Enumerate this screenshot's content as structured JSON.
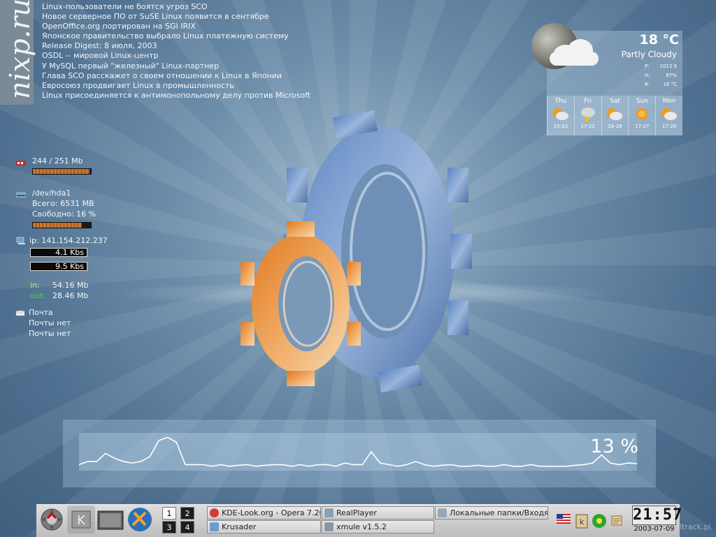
{
  "brand": {
    "logo": "nixp.ru",
    "watermark": "ltrack.pl"
  },
  "news": [
    "Linux-пользователи не боятся угроз SCO",
    "Новое серверное ПО от SuSE Linux появится в сентябре",
    "OpenOffice.org портирован на SGI IRIX",
    "Японское правительство выбрало Linux платежную систему",
    "Release Digest: 8 июля, 2003",
    "OSDL -- мировой Linux-центр",
    "У MySQL первый \"железный\" Linux-партнер",
    "Глава SCO расскажет о своем отношении к Linux в Японии",
    "Евросоюз продвигает Linux в промышленность",
    "Linux присоединяется к антимонопольному делу против Microsoft"
  ],
  "memory": {
    "icon": "memory-icon",
    "text": "244 / 251 Mb",
    "usage": 0.97
  },
  "disk": {
    "icon": "disk-icon",
    "device": "/dev/hda1",
    "total": "Всего: 6531 MB",
    "free": "Свободно: 16 %",
    "usage": 0.84
  },
  "network": {
    "icon": "network-icon",
    "ip": "ip: 141.154.212.237",
    "down_rate": "4.1 Kbs",
    "up_rate": "9.5 Kbs",
    "in_label": "in:",
    "in_value": "54.16 Mb",
    "out_label": "out:",
    "out_value": "28.46 Mb",
    "in_color": "#d8e85a",
    "out_color": "#4fcf4f"
  },
  "mail": {
    "icon": "mail-icon",
    "title": "Почта",
    "line1": "Почты нет",
    "line2": "Почты нет"
  },
  "weather": {
    "temp": "18 °C",
    "condition": "Partly Cloudy",
    "details": [
      {
        "k": "P:",
        "v": "1013.9"
      },
      {
        "k": "H:",
        "v": "87%"
      },
      {
        "k": "R:",
        "v": "18 °C"
      }
    ],
    "forecast": [
      {
        "day": "Thu",
        "range": "15-23",
        "icon": "sun-cloud-icon"
      },
      {
        "day": "Fri",
        "range": "17-22",
        "icon": "storm-icon"
      },
      {
        "day": "Sat",
        "range": "16-26",
        "icon": "sun-cloud-icon"
      },
      {
        "day": "Sun",
        "range": "17-27",
        "icon": "sun-icon"
      },
      {
        "day": "Mon",
        "range": "17-28",
        "icon": "sun-cloud-icon"
      }
    ]
  },
  "cpu": {
    "percent_label": "13 %",
    "load": [
      0.1,
      0.2,
      0.2,
      0.45,
      0.3,
      0.2,
      0.15,
      0.2,
      0.35,
      0.85,
      0.95,
      0.8,
      0.1,
      0.1,
      0.1,
      0.05,
      0.1,
      0.05,
      0.08,
      0.1,
      0.05,
      0.08,
      0.1,
      0.1,
      0.05,
      0.1,
      0.05,
      0.1,
      0.1,
      0.05,
      0.15,
      0.1,
      0.1,
      0.5,
      0.15,
      0.1,
      0.05,
      0.1,
      0.2,
      0.1,
      0.05,
      0.08,
      0.1,
      0.05,
      0.05,
      0.08,
      0.05,
      0.05,
      0.1,
      0.05,
      0.05,
      0.1,
      0.05,
      0.05,
      0.05,
      0.05,
      0.08,
      0.1,
      0.15,
      0.4,
      0.15,
      0.1,
      0.15,
      0.13
    ]
  },
  "taskbar": {
    "desktops": [
      "1",
      "2",
      "3",
      "4"
    ],
    "tasks": [
      {
        "label": "KDE-Look.org - Opera 7.20 Beta",
        "icon": "opera-icon"
      },
      {
        "label": "RealPlayer",
        "icon": "realplayer-icon"
      },
      {
        "label": "Локальные папки/Входящие",
        "icon": "kmail-icon"
      },
      {
        "label": "Krusader",
        "icon": "krusader-icon"
      },
      {
        "label": "xmule v1.5.2",
        "icon": "xmule-icon"
      }
    ],
    "clock": "21:57",
    "date": "2003-07-09"
  }
}
